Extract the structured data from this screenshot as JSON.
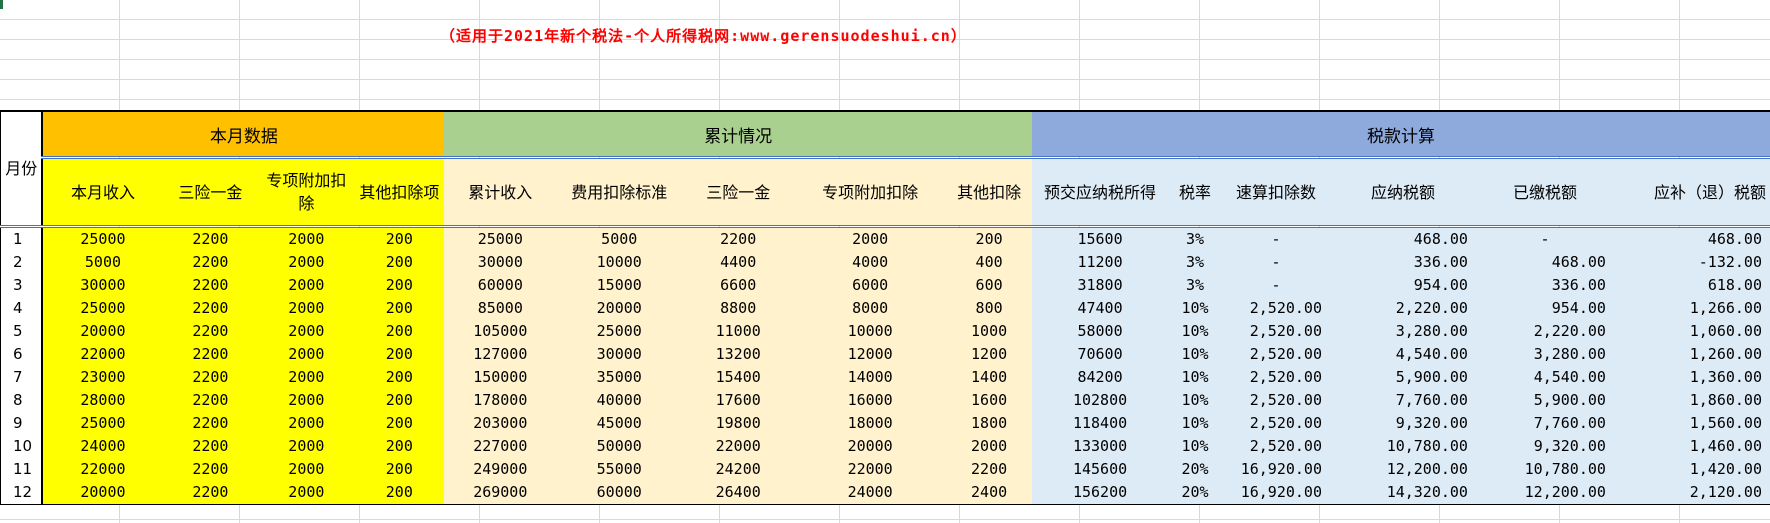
{
  "title": "（适用于2021年新个税法-个人所得税网:www.gerensuodeshui.cn）",
  "header": {
    "month": "月份",
    "group_month": "本月数据",
    "group_cumulative": "累计情况",
    "group_tax": "税款计算"
  },
  "columns": {
    "monthly": [
      "本月收入",
      "三险一金",
      "专项附加扣除",
      "其他扣除项"
    ],
    "cumulative": [
      "累计收入",
      "费用扣除标准",
      "三险一金",
      "专项附加扣除",
      "其他扣除"
    ],
    "tax": [
      "预交应纳税所得",
      "税率",
      "速算扣除数",
      "应纳税额",
      "已缴税额",
      "应补（退）税额"
    ]
  },
  "rows": [
    [
      "1",
      "25000",
      "2200",
      "2000",
      "200",
      "25000",
      "5000",
      "2200",
      "2000",
      "200",
      "15600",
      "3%",
      "-",
      "468.00",
      "-",
      "468.00"
    ],
    [
      "2",
      "5000",
      "2200",
      "2000",
      "200",
      "30000",
      "10000",
      "4400",
      "4000",
      "400",
      "11200",
      "3%",
      "-",
      "336.00",
      "468.00",
      "-132.00"
    ],
    [
      "3",
      "30000",
      "2200",
      "2000",
      "200",
      "60000",
      "15000",
      "6600",
      "6000",
      "600",
      "31800",
      "3%",
      "-",
      "954.00",
      "336.00",
      "618.00"
    ],
    [
      "4",
      "25000",
      "2200",
      "2000",
      "200",
      "85000",
      "20000",
      "8800",
      "8000",
      "800",
      "47400",
      "10%",
      "2,520.00",
      "2,220.00",
      "954.00",
      "1,266.00"
    ],
    [
      "5",
      "20000",
      "2200",
      "2000",
      "200",
      "105000",
      "25000",
      "11000",
      "10000",
      "1000",
      "58000",
      "10%",
      "2,520.00",
      "3,280.00",
      "2,220.00",
      "1,060.00"
    ],
    [
      "6",
      "22000",
      "2200",
      "2000",
      "200",
      "127000",
      "30000",
      "13200",
      "12000",
      "1200",
      "70600",
      "10%",
      "2,520.00",
      "4,540.00",
      "3,280.00",
      "1,260.00"
    ],
    [
      "7",
      "23000",
      "2200",
      "2000",
      "200",
      "150000",
      "35000",
      "15400",
      "14000",
      "1400",
      "84200",
      "10%",
      "2,520.00",
      "5,900.00",
      "4,540.00",
      "1,360.00"
    ],
    [
      "8",
      "28000",
      "2200",
      "2000",
      "200",
      "178000",
      "40000",
      "17600",
      "16000",
      "1600",
      "102800",
      "10%",
      "2,520.00",
      "7,760.00",
      "5,900.00",
      "1,860.00"
    ],
    [
      "9",
      "25000",
      "2200",
      "2000",
      "200",
      "203000",
      "45000",
      "19800",
      "18000",
      "1800",
      "118400",
      "10%",
      "2,520.00",
      "9,320.00",
      "7,760.00",
      "1,560.00"
    ],
    [
      "10",
      "24000",
      "2200",
      "2000",
      "200",
      "227000",
      "50000",
      "22000",
      "20000",
      "2000",
      "133000",
      "10%",
      "2,520.00",
      "10,780.00",
      "9,320.00",
      "1,460.00"
    ],
    [
      "11",
      "22000",
      "2200",
      "2000",
      "200",
      "249000",
      "55000",
      "24200",
      "22000",
      "2200",
      "145600",
      "20%",
      "16,920.00",
      "12,200.00",
      "10,780.00",
      "1,420.00"
    ],
    [
      "12",
      "20000",
      "2200",
      "2000",
      "200",
      "269000",
      "60000",
      "26400",
      "24000",
      "2400",
      "156200",
      "20%",
      "16,920.00",
      "14,320.00",
      "12,200.00",
      "2,120.00"
    ]
  ],
  "colors": {
    "title": "#ff0000",
    "month_group": "#ffc000",
    "month_cells": "#ffff00",
    "cumulative_group": "#a9d08e",
    "cumulative_cells": "#fff2cc",
    "tax_group": "#8ea9db",
    "tax_cells": "#ddebf7"
  }
}
